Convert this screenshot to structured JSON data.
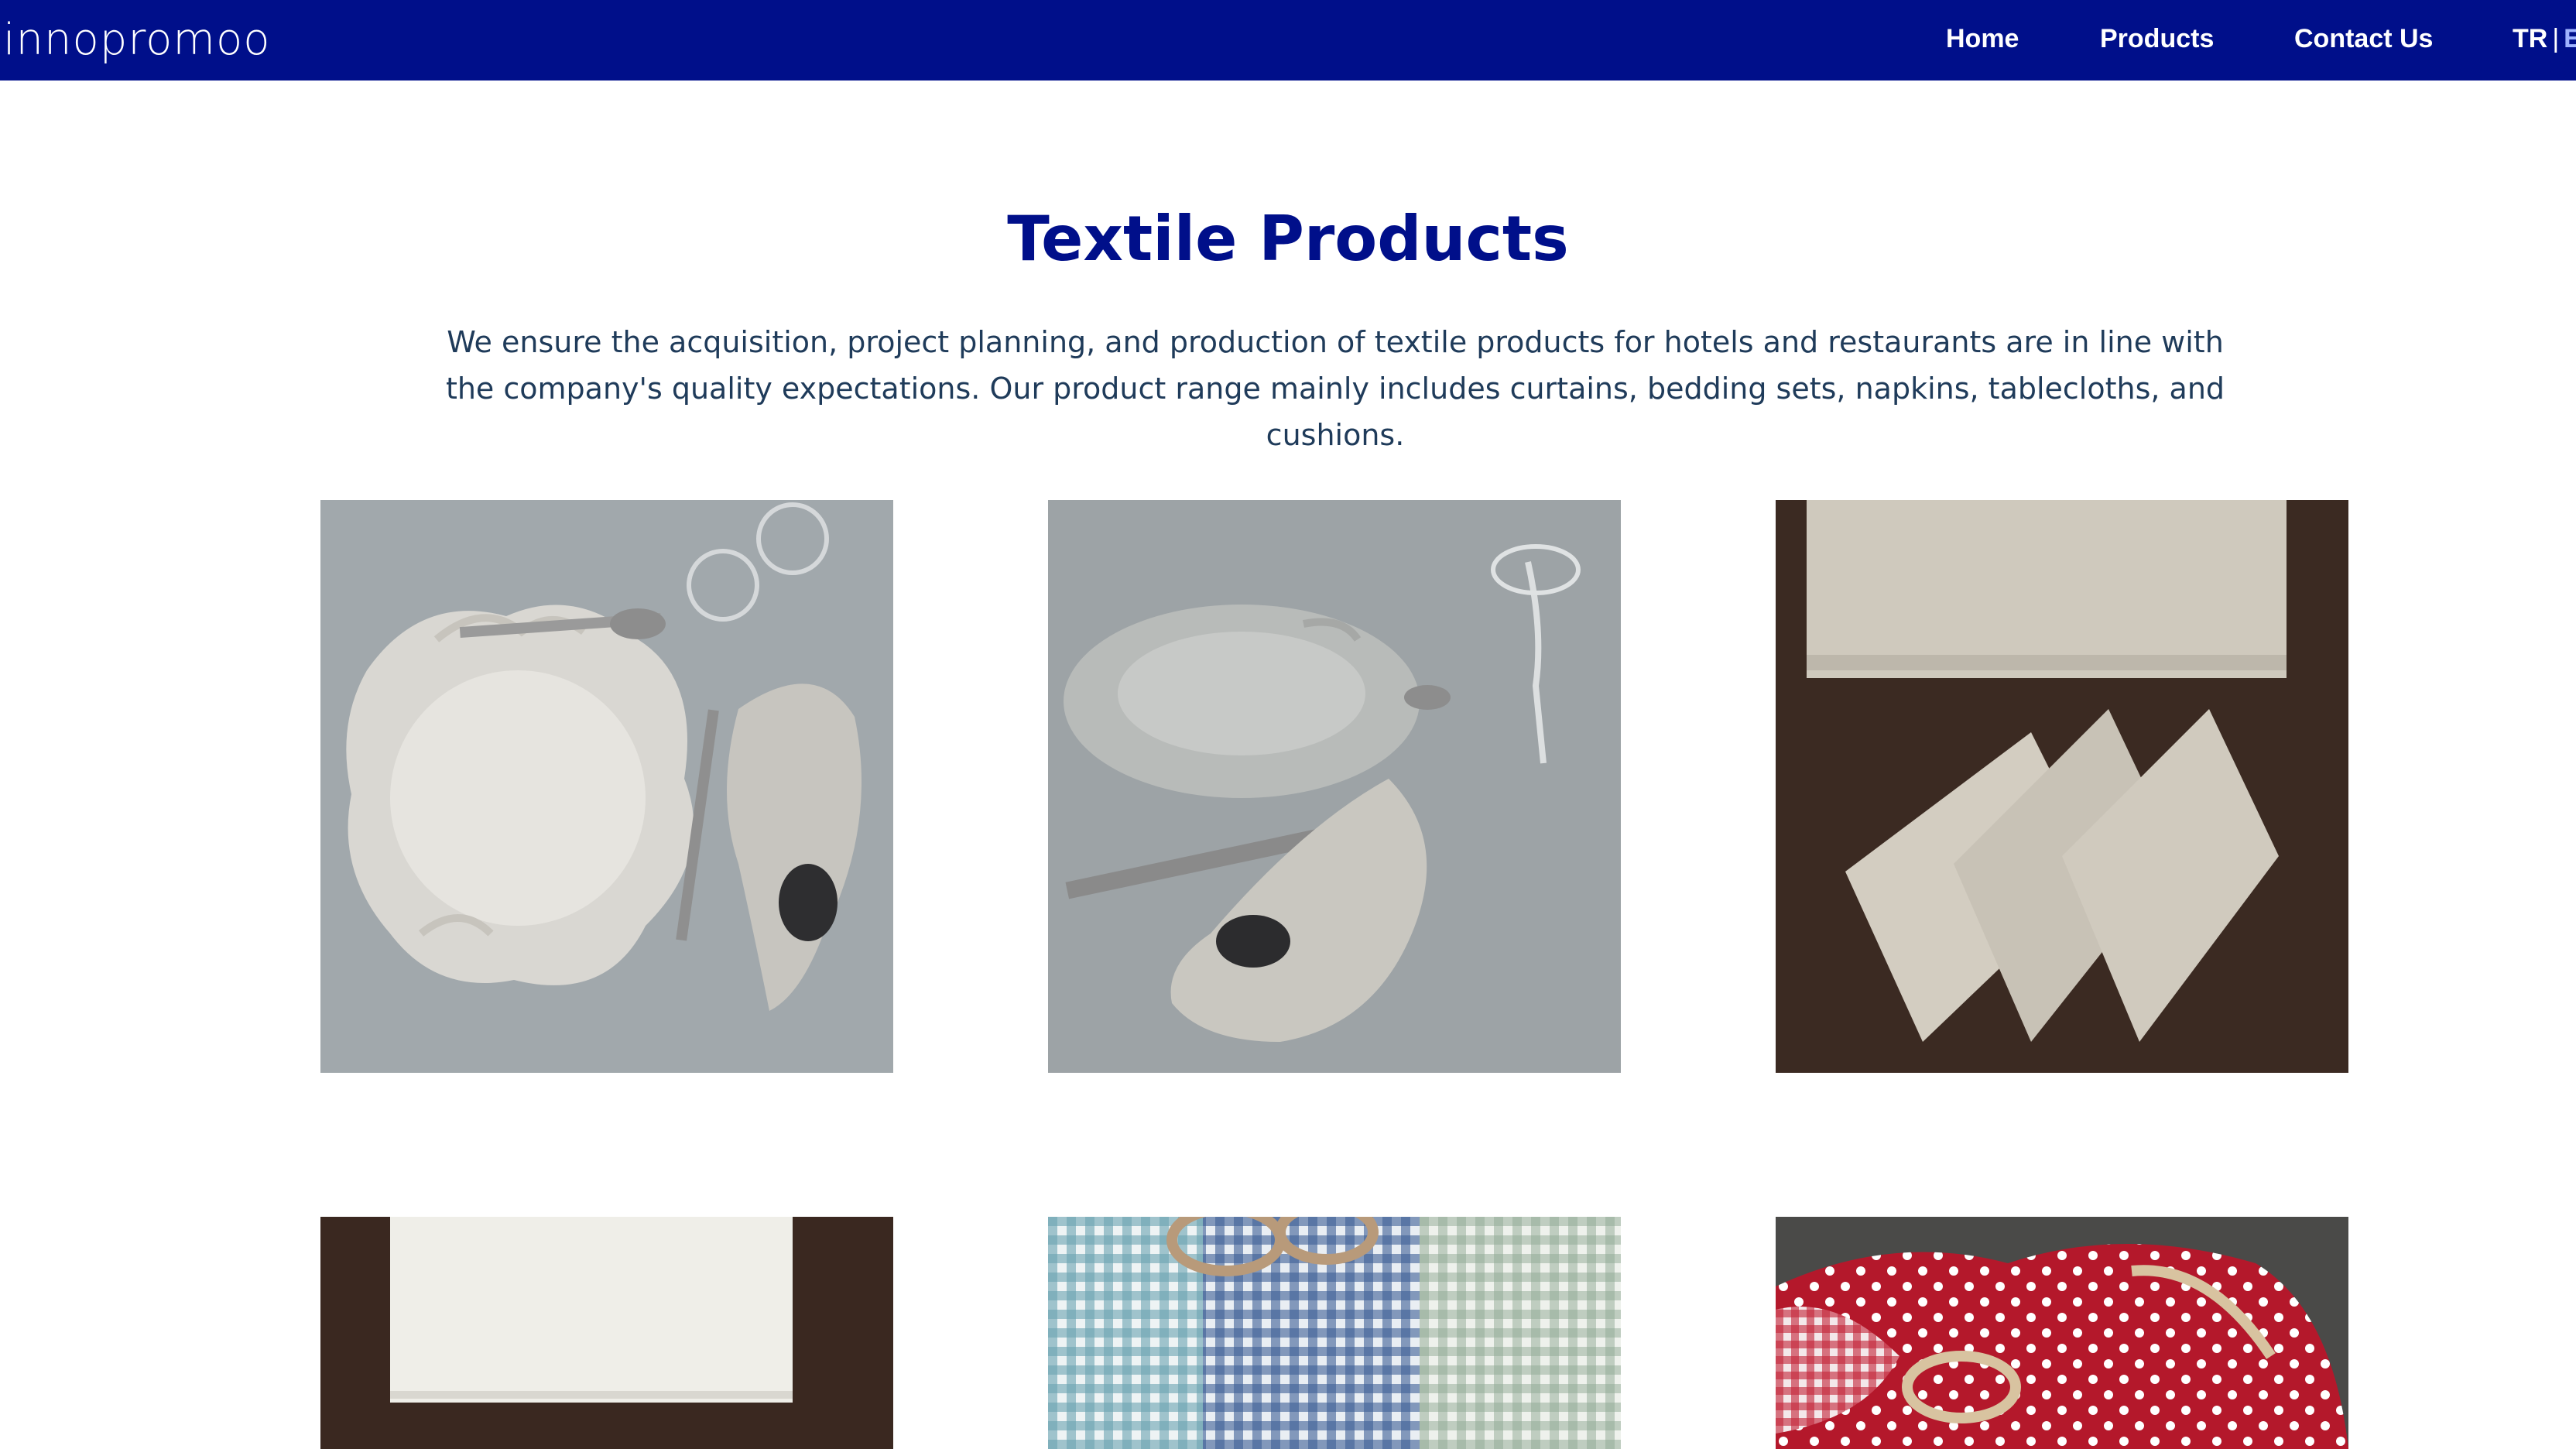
{
  "header": {
    "brand": "innopromoo",
    "nav": [
      "Home",
      "Products",
      "Contact Us"
    ],
    "lang_active": "TR",
    "lang_sep": "|",
    "lang_other": "E"
  },
  "main": {
    "title": "Textile Products",
    "description": "We ensure the acquisition, project planning, and production of textile products for hotels and restaurants are in line with the company's quality expectations. Our product range mainly includes curtains, bedding sets, napkins, tablecloths, and cushions."
  },
  "gallery": [
    {
      "subject": "plate-with-linen-napkin"
    },
    {
      "subject": "table-setting-with-napkin-ring"
    },
    {
      "subject": "folded-linen-napkins"
    },
    {
      "subject": "white-napkin"
    },
    {
      "subject": "gingham-napkins"
    },
    {
      "subject": "polka-dot-napkins"
    }
  ]
}
